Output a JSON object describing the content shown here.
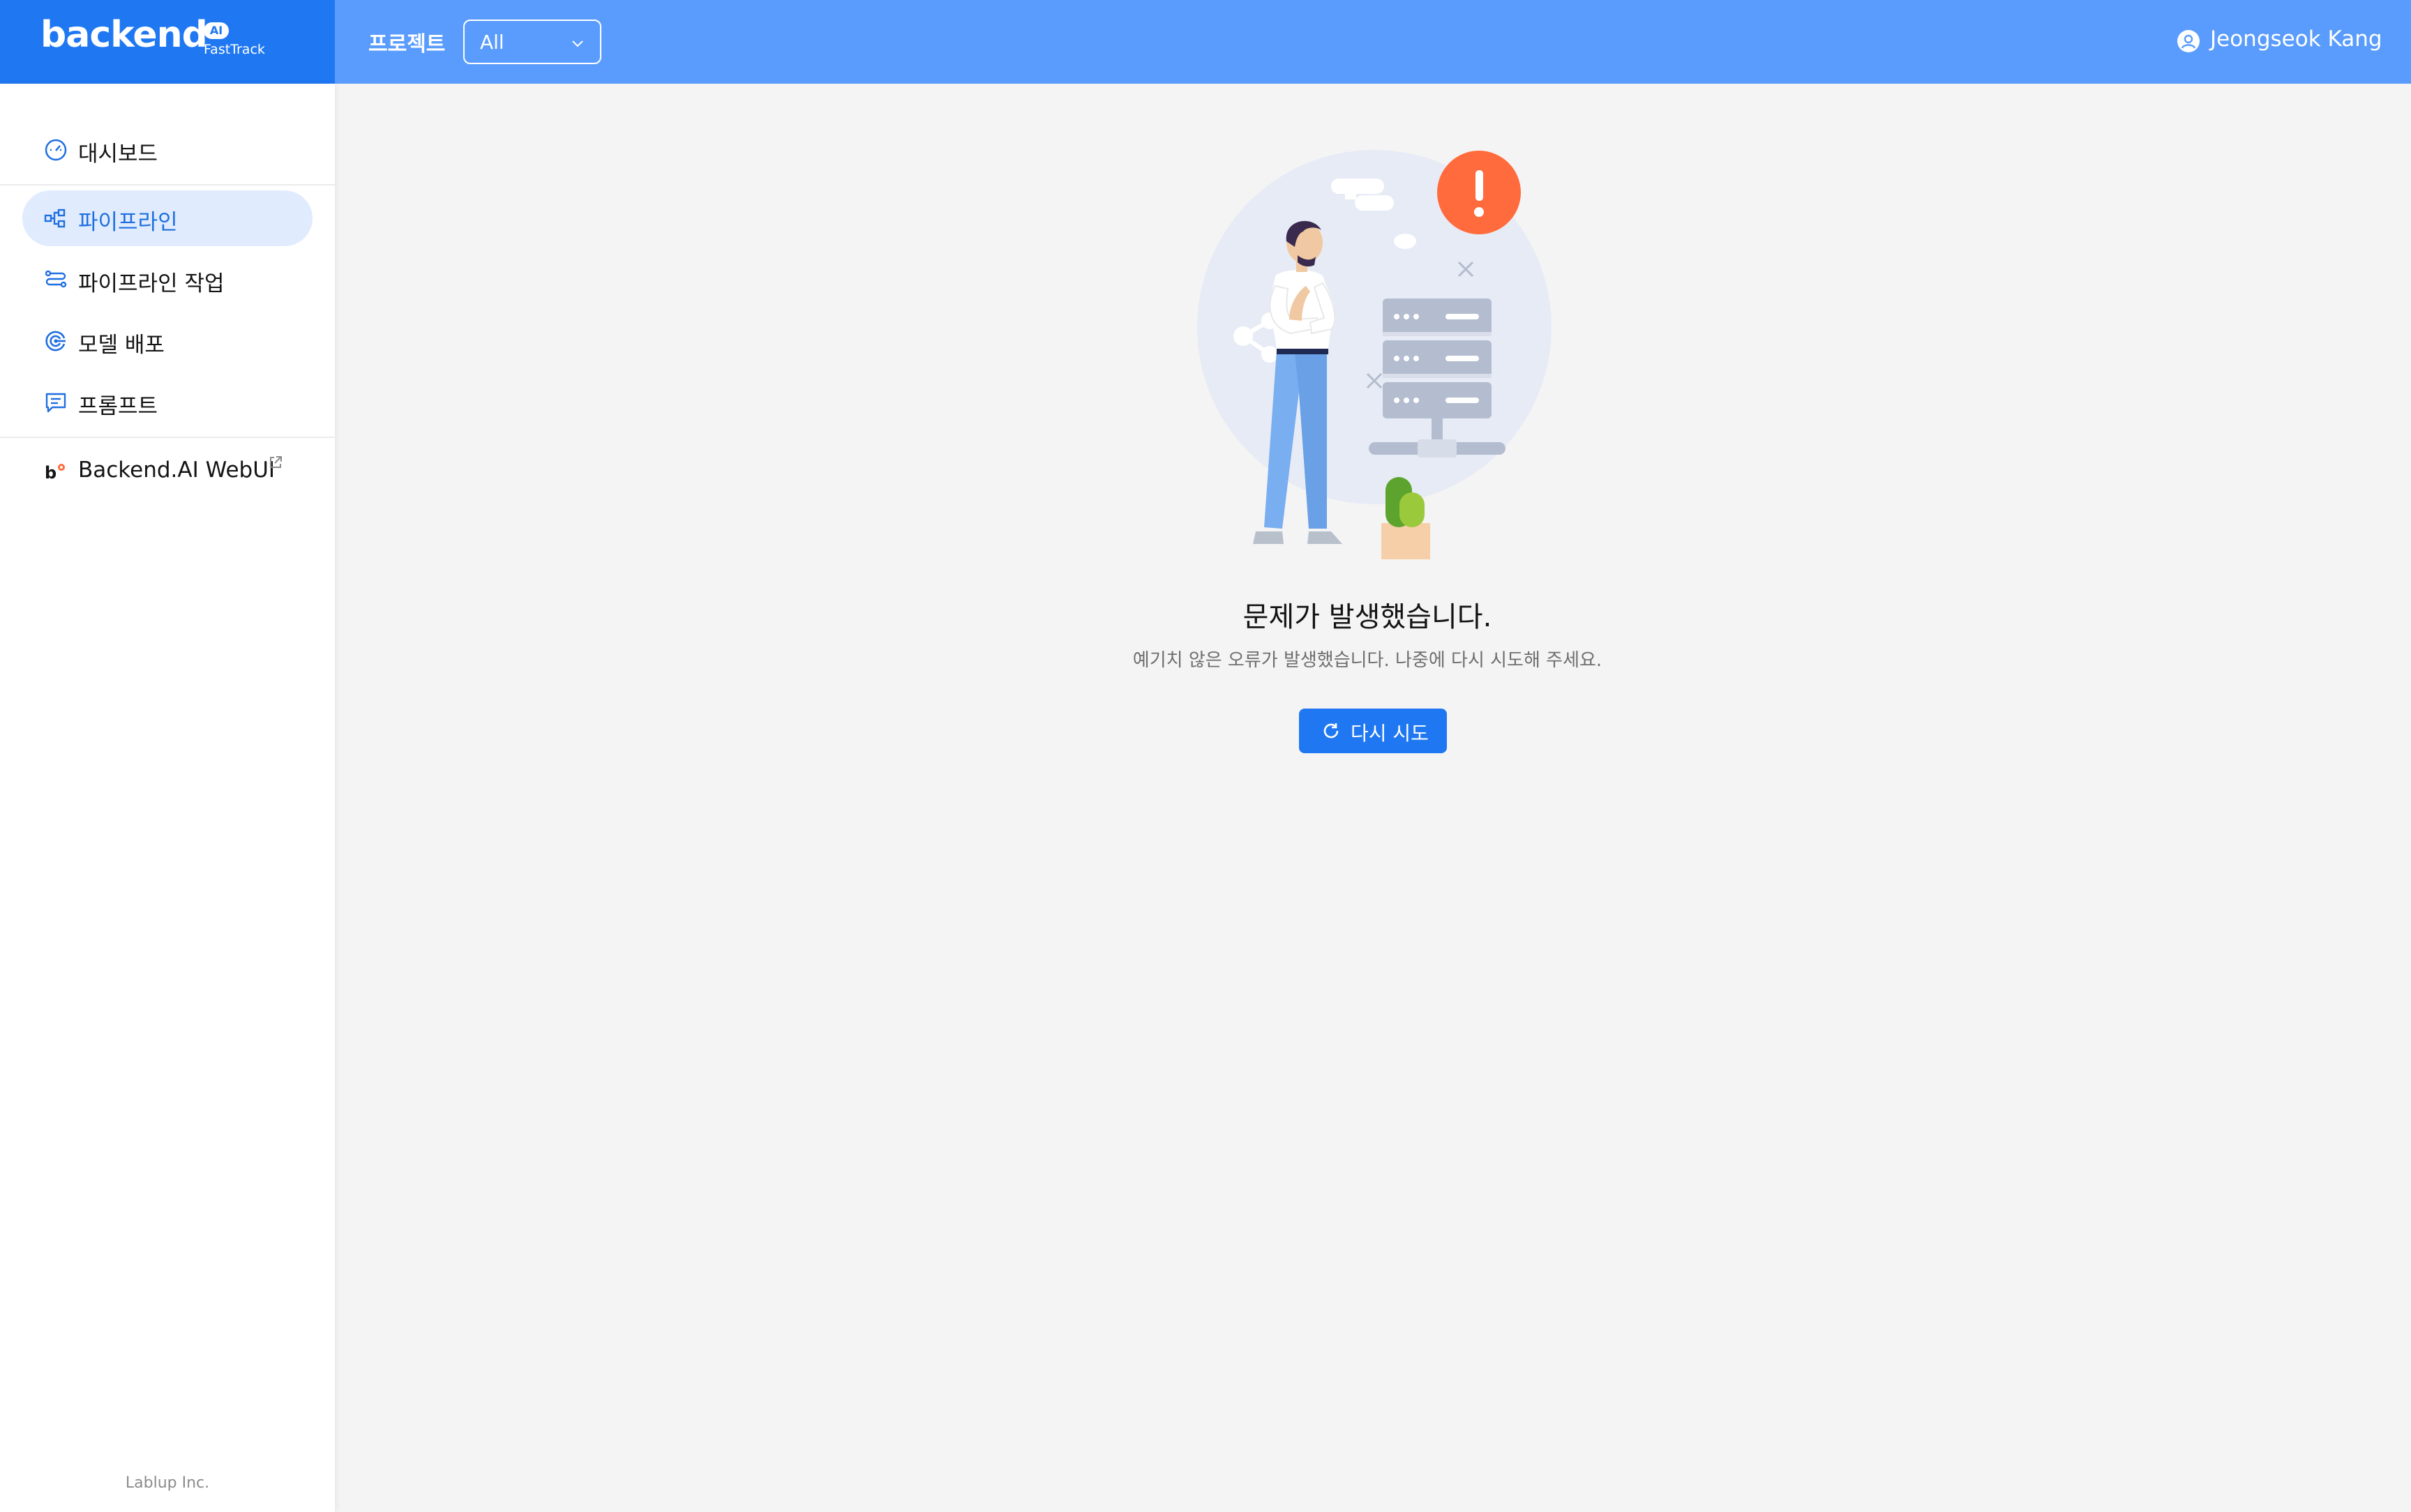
{
  "header": {
    "logo_text": "backend",
    "logo_badge": "AI",
    "logo_sub": "FastTrack",
    "project_label": "프로젝트",
    "project_select_value": "All",
    "user_name": "Jeongseok Kang"
  },
  "sidebar": {
    "items": [
      {
        "label": "대시보드",
        "icon": "dashboard-icon",
        "active": false
      },
      {
        "label": "파이프라인",
        "icon": "pipeline-icon",
        "active": true
      },
      {
        "label": "파이프라인 작업",
        "icon": "pipeline-job-icon",
        "active": false
      },
      {
        "label": "모델 배포",
        "icon": "model-deploy-icon",
        "active": false
      },
      {
        "label": "프롬프트",
        "icon": "prompt-icon",
        "active": false
      },
      {
        "label": "Backend.AI WebUI",
        "icon": "backendai-logo-icon",
        "active": false,
        "external": true
      }
    ],
    "footer": "Lablup Inc."
  },
  "main": {
    "error_title": "문제가 발생했습니다.",
    "error_description": "예기치 않은 오류가 발생했습니다. 나중에 다시 시도해 주세요.",
    "retry_label": "다시 시도"
  },
  "colors": {
    "header_bg": "#5a9cfd",
    "logo_bg": "#1f78f2",
    "accent": "#1f78f2",
    "active_nav_bg": "#e0ecfe",
    "active_nav_text": "#1f6fe0",
    "main_bg": "#f4f4f4",
    "alert": "#ff6b3d"
  }
}
